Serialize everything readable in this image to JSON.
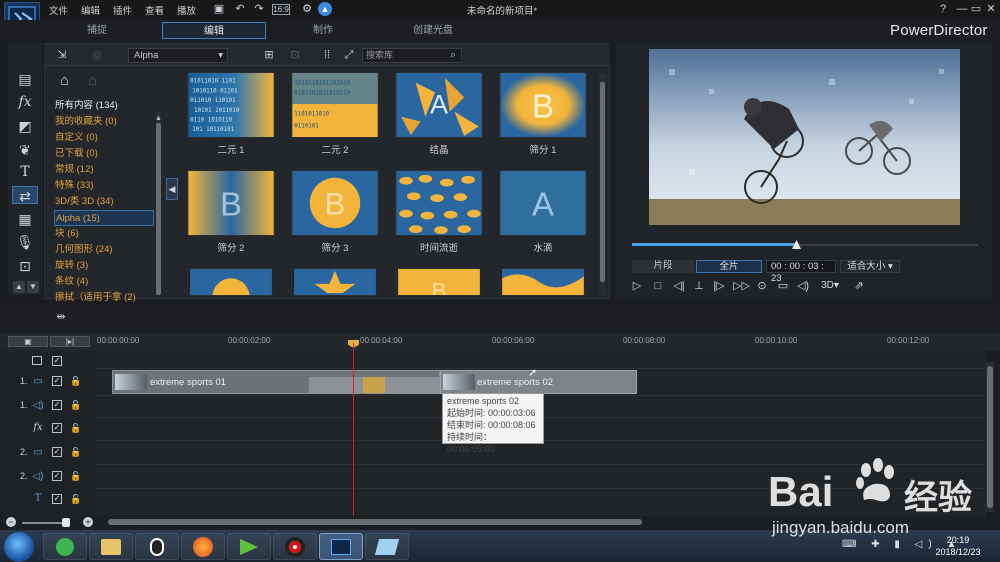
{
  "app": {
    "project_title": "未命名的新项目*",
    "brand": "PowerDirector"
  },
  "menu": [
    "文件",
    "编辑",
    "插件",
    "查看",
    "播放"
  ],
  "window_controls": {
    "help": "?",
    "minimize": "—",
    "restore": "▭",
    "close": "✕"
  },
  "mode_tabs": [
    "捕捉",
    "编辑",
    "制作",
    "创建光盘"
  ],
  "library": {
    "category_select": "Alpha",
    "search_placeholder": "搜索库",
    "categories": [
      {
        "label": "所有内容 (134)"
      },
      {
        "label": "我的收藏夹  (0)"
      },
      {
        "label": "自定义  (0)"
      },
      {
        "label": "已下载  (0)"
      },
      {
        "label": "常规  (12)"
      },
      {
        "label": "特殊  (33)"
      },
      {
        "label": "3D/类 3D  (34)"
      },
      {
        "label": "Alpha  (15)"
      },
      {
        "label": "块  (6)"
      },
      {
        "label": "几何图形  (24)"
      },
      {
        "label": "旋转  (3)"
      },
      {
        "label": "条纹  (4)"
      },
      {
        "label": "擦拭（适用于拿  (2)"
      }
    ],
    "thumbnails": [
      {
        "label": "二元 1",
        "kind": "binary"
      },
      {
        "label": "二元 2",
        "kind": "binary2"
      },
      {
        "label": "结晶",
        "kind": "crystal"
      },
      {
        "label": "筛分 1",
        "kind": "sieve1"
      },
      {
        "label": "筛分 2",
        "kind": "sieve2"
      },
      {
        "label": "筛分 3",
        "kind": "sieve3"
      },
      {
        "label": "时间流逝",
        "kind": "leaves"
      },
      {
        "label": "水滴",
        "kind": "drops"
      }
    ]
  },
  "preview": {
    "segment_clip": "片段",
    "segment_movie": "全片",
    "timecode": "00 : 00 : 03 : 23",
    "zoom": "适合大小",
    "mode_3d": "3D"
  },
  "timeline": {
    "ruler": [
      "00:00:00:00",
      "00:00:02:00",
      "00:00:04:00",
      "00:00:06:00",
      "00:00:08:00",
      "00:00:10:00",
      "00:00:12:00"
    ],
    "tracks": [
      {
        "label": "1.",
        "type": "video"
      },
      {
        "label": "1.",
        "type": "audio"
      },
      {
        "label": "",
        "type": "fx"
      },
      {
        "label": "2.",
        "type": "video"
      },
      {
        "label": "2.",
        "type": "audio"
      },
      {
        "label": "",
        "type": "title"
      }
    ],
    "clips": [
      {
        "title": "extreme sports 01"
      },
      {
        "title": "extreme sports 02"
      }
    ],
    "tooltip": {
      "title": "extreme sports 02",
      "start": "起始时间: 00:00:03:06",
      "end": "结束时间: 00:00:08:06",
      "duration": "持续时间：  00:00:05:00"
    }
  },
  "taskbar": {
    "time": "20:19",
    "date": "2018/12/23"
  },
  "watermark": {
    "brand": "Bai",
    "brand2": "经验",
    "url": "jingyan.baidu.com"
  },
  "colors": {
    "accent": "#3b7fc4",
    "category_text": "#e0a13c",
    "playhead": "#d0242b"
  }
}
